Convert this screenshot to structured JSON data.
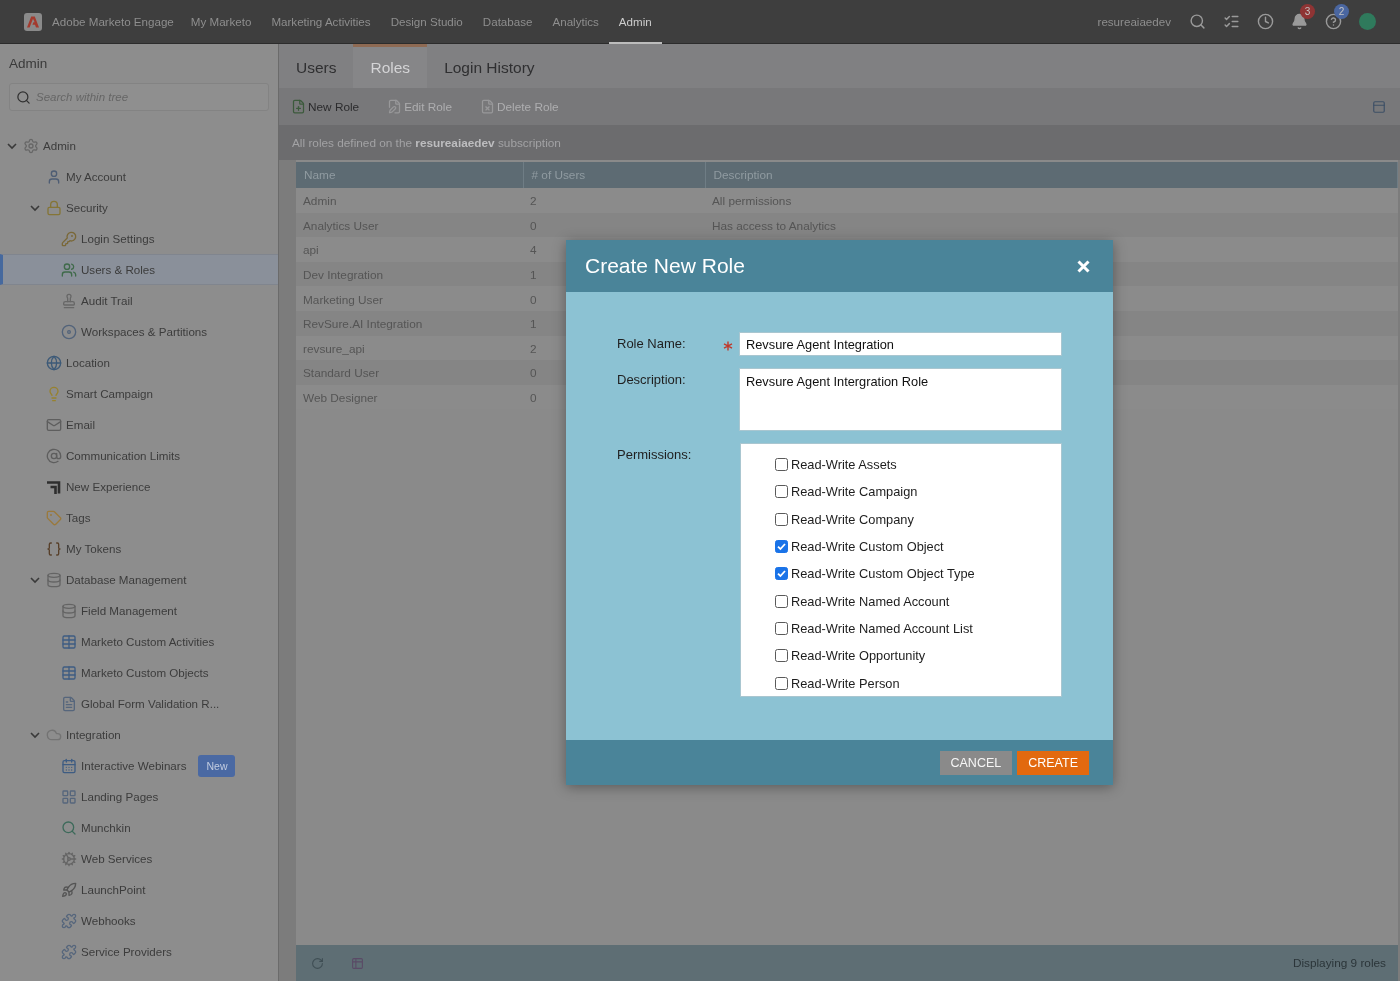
{
  "top_bar": {
    "app_name": "Adobe Marketo Engage",
    "nav": [
      {
        "label": "My Marketo",
        "selected": false
      },
      {
        "label": "Marketing Activities",
        "selected": false
      },
      {
        "label": "Design Studio",
        "selected": false
      },
      {
        "label": "Database",
        "selected": false
      },
      {
        "label": "Analytics",
        "selected": false
      },
      {
        "label": "Admin",
        "selected": true
      }
    ],
    "username": "resureaiaedev",
    "notifications": {
      "count": "3"
    },
    "help": {
      "count": "2"
    }
  },
  "sidebar": {
    "title": "Admin",
    "search": {
      "placeholder": "Search within tree"
    },
    "tree": [
      {
        "label": "Admin",
        "selected": false,
        "expanded": true,
        "children": [
          {
            "label": "My Account",
            "selected": false
          },
          {
            "label": "Security",
            "selected": false,
            "expanded": true,
            "children": [
              {
                "label": "Login Settings",
                "selected": false
              },
              {
                "label": "Users & Roles",
                "selected": true
              },
              {
                "label": "Audit Trail",
                "selected": false
              },
              {
                "label": "Workspaces & Partitions",
                "selected": false
              }
            ]
          },
          {
            "label": "Location",
            "selected": false
          },
          {
            "label": "Smart Campaign",
            "selected": false
          },
          {
            "label": "Email",
            "selected": false
          },
          {
            "label": "Communication Limits",
            "selected": false
          },
          {
            "label": "New Experience",
            "selected": false
          },
          {
            "label": "Tags",
            "selected": false
          },
          {
            "label": "My Tokens",
            "selected": false
          },
          {
            "label": "Database Management",
            "selected": false,
            "expanded": true,
            "children": [
              {
                "label": "Field Management",
                "selected": false
              },
              {
                "label": "Marketo Custom Activities",
                "selected": false
              },
              {
                "label": "Marketo Custom Objects",
                "selected": false
              },
              {
                "label": "Global Form Validation R...",
                "selected": false
              }
            ]
          },
          {
            "label": "Integration",
            "selected": false,
            "expanded": true,
            "children": [
              {
                "label": "Interactive Webinars",
                "selected": false,
                "badge": "New"
              },
              {
                "label": "Landing Pages",
                "selected": false
              },
              {
                "label": "Munchkin",
                "selected": false
              },
              {
                "label": "Web Services",
                "selected": false
              },
              {
                "label": "LaunchPoint",
                "selected": false
              },
              {
                "label": "Webhooks",
                "selected": false
              },
              {
                "label": "Service Providers",
                "selected": false
              }
            ]
          }
        ]
      }
    ]
  },
  "tabs": [
    {
      "label": "Users",
      "selected": false
    },
    {
      "label": "Roles",
      "selected": true
    },
    {
      "label": "Login History",
      "selected": false
    }
  ],
  "toolbar": {
    "buttons": [
      {
        "label": "New Role",
        "kind": "add",
        "disabled": false
      },
      {
        "label": "Edit Role",
        "kind": "edit",
        "disabled": true
      },
      {
        "label": "Delete Role",
        "kind": "delete",
        "disabled": true
      }
    ]
  },
  "info": "All roles defined on the **resureaiaedev** subscription",
  "table": {
    "columns": [
      "Name",
      "# of Users",
      "Description"
    ],
    "rows": [
      {
        "name": "Admin",
        "users": "2",
        "description": "All permissions"
      },
      {
        "name": "Analytics User",
        "users": "0",
        "description": "Has access to Analytics"
      },
      {
        "name": "api",
        "users": "4"
      },
      {
        "name": "Dev Integration",
        "users": "1"
      },
      {
        "name": "Marketing User",
        "users": "0"
      },
      {
        "name": "RevSure.AI Integration",
        "users": "1"
      },
      {
        "name": "revsure_api",
        "users": "2"
      },
      {
        "name": "Standard User",
        "users": "0"
      },
      {
        "name": "Web Designer",
        "users": "0"
      }
    ]
  },
  "status_bar": {
    "text": "Displaying 9 roles"
  },
  "dialog": {
    "title": "Create New Role",
    "fields": [
      {
        "label": "Role Name:",
        "kind": "text",
        "required": true,
        "value": "Revsure Agent Integration"
      },
      {
        "label": "Description:",
        "kind": "textarea",
        "required": false,
        "value": "Revsure Agent Intergration Role"
      }
    ],
    "permissions": {
      "label": "Permissions:",
      "items": [
        {
          "label": "Read-Write Assets",
          "checked": false
        },
        {
          "label": "Read-Write Campaign",
          "checked": false
        },
        {
          "label": "Read-Write Company",
          "checked": false
        },
        {
          "label": "Read-Write Custom Object",
          "checked": true
        },
        {
          "label": "Read-Write Custom Object Type",
          "checked": true
        },
        {
          "label": "Read-Write Named Account",
          "checked": false
        },
        {
          "label": "Read-Write Named Account List",
          "checked": false
        },
        {
          "label": "Read-Write Opportunity",
          "checked": false
        },
        {
          "label": "Read-Write Person",
          "checked": false
        }
      ]
    },
    "buttons": [
      {
        "label": "CANCEL",
        "kind": "secondary"
      },
      {
        "label": "CREATE",
        "kind": "primary"
      }
    ]
  }
}
